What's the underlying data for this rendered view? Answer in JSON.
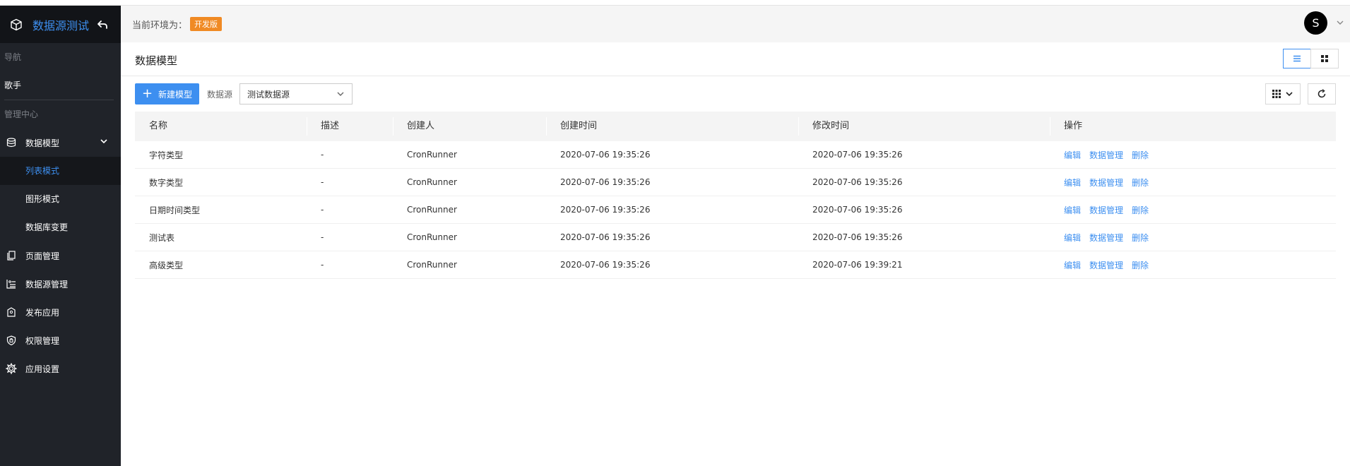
{
  "app": {
    "title": "数据源测试"
  },
  "sidebar": {
    "nav_section": "导航",
    "nav_plain": "歌手",
    "admin_section": "管理中心",
    "data_model": {
      "label": "数据模型",
      "icon": "database-icon"
    },
    "sub_items": [
      {
        "label": "列表模式",
        "active": true
      },
      {
        "label": "图形模式",
        "active": false
      },
      {
        "label": "数据库变更",
        "active": false
      }
    ],
    "items": [
      {
        "label": "页面管理",
        "icon": "pages-icon"
      },
      {
        "label": "数据源管理",
        "icon": "datasource-icon"
      },
      {
        "label": "发布应用",
        "icon": "publish-icon"
      },
      {
        "label": "权限管理",
        "icon": "shield-icon"
      },
      {
        "label": "应用设置",
        "icon": "gear-icon"
      }
    ]
  },
  "topbar": {
    "env_label": "当前环境为：",
    "env_badge": "开发版",
    "avatar_letter": "S",
    "badge_color": "#f08a24"
  },
  "page": {
    "title": "数据模型"
  },
  "toolbar": {
    "new_label": "新建模型",
    "ds_label": "数据源",
    "ds_value": "测试数据源"
  },
  "table": {
    "headers": [
      "名称",
      "描述",
      "创建人",
      "创建时间",
      "修改时间",
      "操作"
    ],
    "rows": [
      {
        "name": "字符类型",
        "desc": "-",
        "creator": "CronRunner",
        "created": "2020-07-06 19:35:26",
        "modified": "2020-07-06 19:35:26"
      },
      {
        "name": "数字类型",
        "desc": "-",
        "creator": "CronRunner",
        "created": "2020-07-06 19:35:26",
        "modified": "2020-07-06 19:35:26"
      },
      {
        "name": "日期时间类型",
        "desc": "-",
        "creator": "CronRunner",
        "created": "2020-07-06 19:35:26",
        "modified": "2020-07-06 19:35:26"
      },
      {
        "name": "测试表",
        "desc": "-",
        "creator": "CronRunner",
        "created": "2020-07-06 19:35:26",
        "modified": "2020-07-06 19:35:26"
      },
      {
        "name": "高级类型",
        "desc": "-",
        "creator": "CronRunner",
        "created": "2020-07-06 19:35:26",
        "modified": "2020-07-06 19:39:21"
      }
    ],
    "actions": {
      "edit": "编辑",
      "manage": "数据管理",
      "delete": "删除"
    }
  },
  "colors": {
    "accent": "#3d8ff0",
    "sidebar_bg": "#202329"
  }
}
